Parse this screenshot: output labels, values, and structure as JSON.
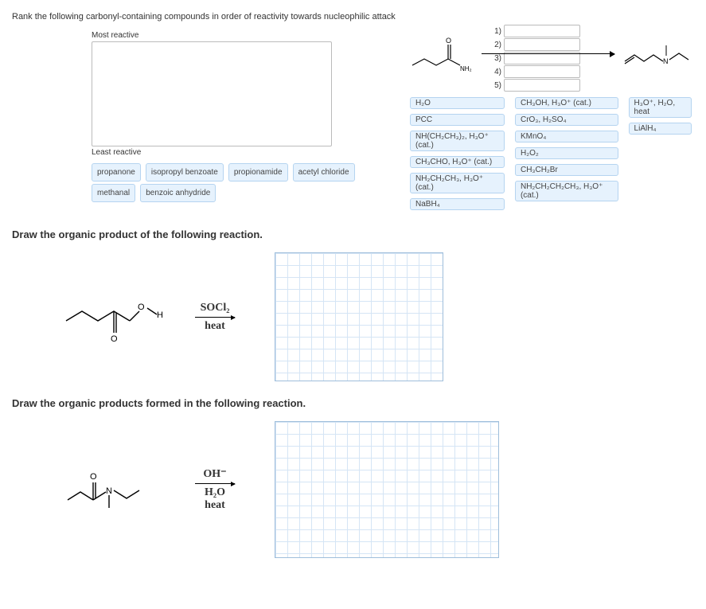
{
  "q1": {
    "prompt": "Rank the following carbonyl-containing compounds in order of reactivity towards nucleophilic attack",
    "most_label": "Most reactive",
    "least_label": "Least reactive",
    "choices": [
      "propanone",
      "isopropyl benzoate",
      "propionamide",
      "acetyl chloride",
      "methanal",
      "benzoic anhydride"
    ]
  },
  "rxn_top": {
    "slots": [
      "1)",
      "2)",
      "3)",
      "4)",
      "5)"
    ],
    "reagents_col1": [
      "H₂O",
      "PCC",
      "NH(CH₂CH₃)₂, H₃O⁺ (cat.)",
      "CH₃CHO, H₃O⁺ (cat.)",
      "NH₂CH₂CH₃, H₃O⁺ (cat.)",
      "NaBH₄"
    ],
    "reagents_col2": [
      "CH₃OH, H₃O⁺ (cat.)",
      "CrO₃, H₂SO₄",
      "KMnO₄",
      "H₂O₂",
      "CH₃CH₂Br",
      "NH₂CH₂CH₂CH₃, H₃O⁺ (cat.)"
    ],
    "reagents_col3": [
      "H₃O⁺, H₂O, heat",
      "LiAlH₄"
    ]
  },
  "q2": {
    "prompt": "Draw the organic product of the following reaction.",
    "cond_top": "SOCl₂",
    "cond_bot": "heat"
  },
  "q3": {
    "prompt": "Draw the organic products formed in the following reaction.",
    "cond_top": "OH⁻",
    "cond_mid": "H₂O",
    "cond_bot": "heat"
  }
}
